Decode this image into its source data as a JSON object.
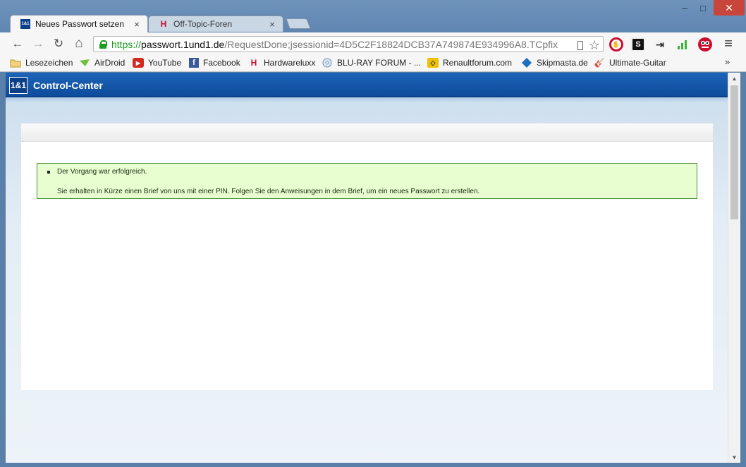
{
  "window": {
    "minimize_glyph": "–",
    "maximize_glyph": "□",
    "close_glyph": "✕"
  },
  "tabs": [
    {
      "title": "Neues Passwort setzen",
      "favicon": "1&1",
      "favicon_color": "#0b3f88",
      "close": "×"
    },
    {
      "title": "Off-Topic-Foren",
      "favicon": "H",
      "favicon_color": "#c8102e",
      "close": "×"
    }
  ],
  "toolbar": {
    "back_icon": "←",
    "forward_icon": "→",
    "reload_icon": "↻",
    "home_icon": "⌂",
    "url_scheme": "https://",
    "url_host": "passwort.1und1.de",
    "url_path": "/RequestDone;jsessionid=4D5C2F18824DCB37A749874E934996A8.TCpfix",
    "star_icon": "☆",
    "menu_icon": "≡"
  },
  "bookmarks": [
    {
      "label": "Lesezeichen",
      "icon": "folder-icon"
    },
    {
      "label": "AirDroid",
      "icon": "airdroid-icon"
    },
    {
      "label": "YouTube",
      "icon": "youtube-icon"
    },
    {
      "label": "Facebook",
      "icon": "facebook-icon"
    },
    {
      "label": "Hardwareluxx",
      "icon": "hardwareluxx-icon"
    },
    {
      "label": "BLU-RAY FORUM - ...",
      "icon": "bluray-icon"
    },
    {
      "label": "Renaultforum.com",
      "icon": "renault-icon"
    },
    {
      "label": "Skipmasta.de",
      "icon": "skipmasta-icon"
    },
    {
      "label": "Ultimate-Guitar",
      "icon": "guitar-icon"
    }
  ],
  "bookmarks_more": "»",
  "page": {
    "logo": "1&1",
    "header_title": "Control-Center",
    "message_title": "Der Vorgang war erfolgreich.",
    "message_body": "Sie erhalten in Kürze einen Brief von uns mit einer PIN. Folgen Sie den Anweisungen in dem Brief, um ein neues Passwort zu erstellen."
  },
  "colors": {
    "header_blue": "#0e4c9c",
    "success_bg": "#e8fdd0",
    "success_border": "#4b8f3a",
    "secure_green": "#1f9b23"
  }
}
